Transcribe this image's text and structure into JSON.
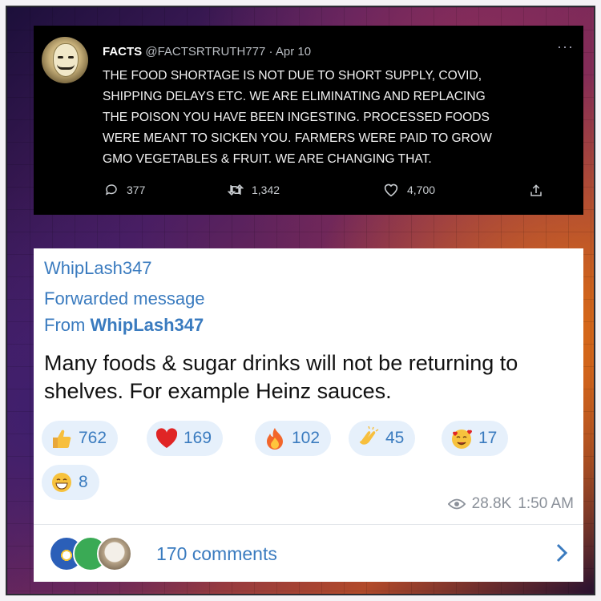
{
  "tweet": {
    "name": "FACTS",
    "handle": "@FACTSRTRUTH777",
    "date": "Apr 10",
    "separator": "·",
    "more": "···",
    "body": "THE FOOD SHORTAGE IS NOT DUE TO SHORT SUPPLY, COVID,\nSHIPPING DELAYS ETC. WE ARE ELIMINATING AND REPLACING\nTHE POISON YOU HAVE BEEN INGESTING. PROCESSED FOODS\nWERE MEANT TO SICKEN YOU. FARMERS WERE PAID TO GROW\nGMO VEGETABLES & FRUIT. WE ARE CHANGING THAT.",
    "replies": "377",
    "retweets": "1,342",
    "likes": "4,700",
    "icons": [
      "comment-icon",
      "retweet-icon",
      "heart-icon",
      "share-icon"
    ]
  },
  "telegram": {
    "author": "WhipLash347",
    "forwarded_label": "Forwarded message",
    "from_prefix": "From",
    "from_name": "WhipLash347",
    "message": "Many foods & sugar drinks will not be returning to shelves. For example Heinz sauces.",
    "reactions": [
      {
        "emoji": "thumbs-up",
        "count": "762"
      },
      {
        "emoji": "red-heart",
        "count": "169"
      },
      {
        "emoji": "fire",
        "count": "102"
      },
      {
        "emoji": "clapping-hands",
        "count": "45"
      },
      {
        "emoji": "smiling-face-with-hearts",
        "count": "17"
      },
      {
        "emoji": "grinning-face",
        "count": "8"
      }
    ],
    "views": "28.8K",
    "time": "1:50 AM",
    "comments_label": "170 comments"
  },
  "colors": {
    "telegram_blue": "#3a7bbf",
    "reaction_pill": "#e6f0fb",
    "tweet_bg": "#000000"
  }
}
